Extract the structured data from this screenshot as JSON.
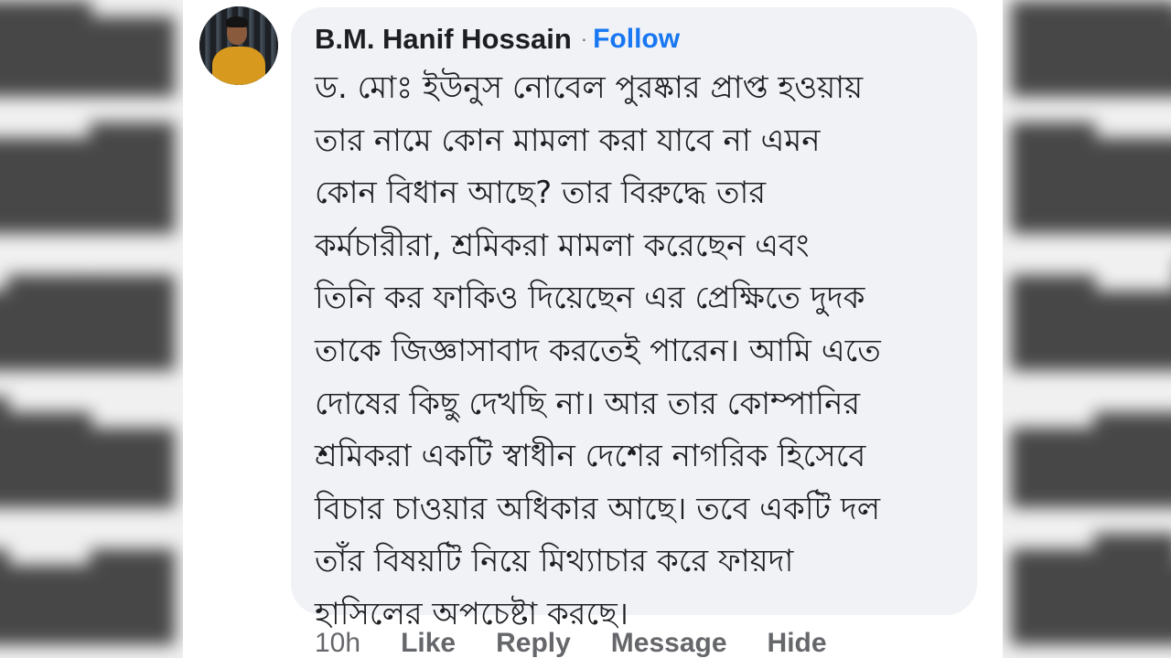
{
  "comment": {
    "author": "B.M. Hanif Hossain",
    "separator": "·",
    "follow_label": "Follow",
    "text_lines": [
      "ড. মোঃ ইউনুস নোবেল পুরষ্কার প্রাপ্ত হওয়ায়",
      "তার নামে কোন মামলা করা যাবে না এমন",
      "কোন বিধান আছে? তার বিরুদ্ধে তার",
      "কর্মচারীরা, শ্রমিকরা মামলা করেছেন এবং",
      "তিনি কর ফাকিও দিয়েছেন এর প্রেক্ষিতে দুদক",
      "তাকে জিজ্ঞাসাবাদ করতেই পারেন। আমি এতে",
      "দোষের কিছু দেখছি না। আর তার কোম্পানির",
      "শ্রমিকরা একটি স্বাধীন দেশের নাগরিক হিসেবে",
      "বিচার চাওয়ার অধিকার আছে। তবে একটি দল",
      "তাঁর বিষয়টি নিয়ে মিথ্যাচার করে ফায়দা",
      "হাসিলের অপচেষ্টা করছে।"
    ]
  },
  "actions": {
    "time": "10h",
    "like": "Like",
    "reply": "Reply",
    "message": "Message",
    "hide": "Hide"
  },
  "colors": {
    "bubble": "#f0f2f5",
    "follow": "#1877f2",
    "text": "#1c1e21",
    "muted": "#65676b"
  }
}
